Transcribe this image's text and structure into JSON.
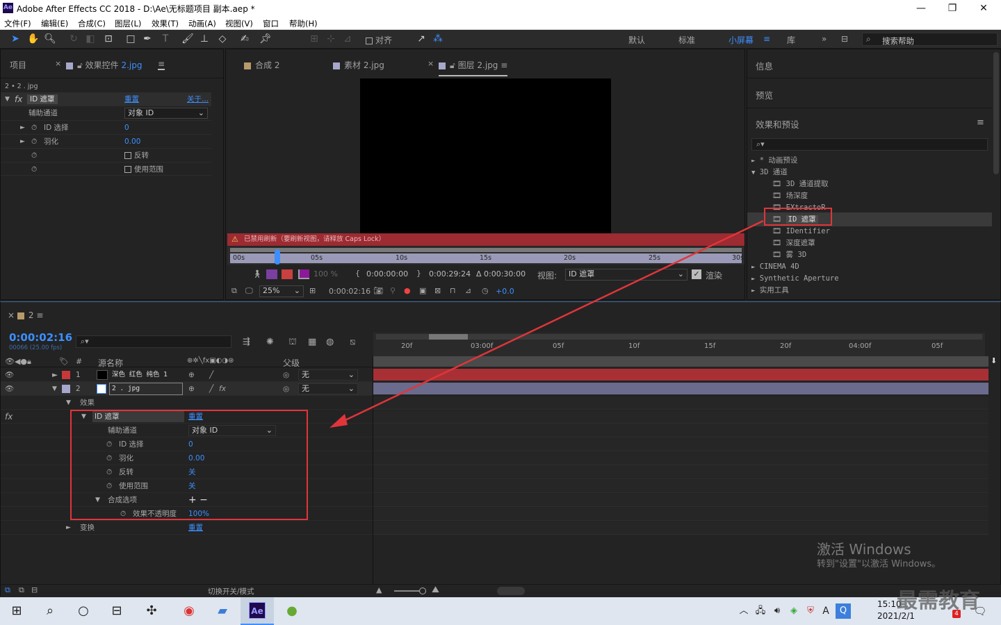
{
  "app": {
    "logo": "Ae",
    "title": "Adobe After Effects CC 2018 - D:\\Ae\\无标题项目 副本.aep *"
  },
  "window_controls": {
    "minimize": "—",
    "restore": "❐",
    "close": "✕"
  },
  "menu": [
    "文件(F)",
    "编辑(E)",
    "合成(C)",
    "图层(L)",
    "效果(T)",
    "动画(A)",
    "视图(V)",
    "窗口",
    "帮助(H)"
  ],
  "toolbar": {
    "align_label": "对齐",
    "workspaces": [
      "默认",
      "标准",
      "小屏幕",
      "库"
    ],
    "active_workspace": "小屏幕",
    "search_placeholder": "搜索帮助"
  },
  "left_panel": {
    "tab_project": "项目",
    "tab_effects_prefix": "效果控件",
    "tab_effects_layer": "2.jpg",
    "breadcrumb": "2 • 2 . jpg",
    "effect_name": "ID 遮罩",
    "reset": "重置",
    "about": "关于...",
    "props": [
      {
        "label": "辅助通道",
        "value": "对象 ID"
      },
      {
        "label": "ID 选择",
        "value": "0"
      },
      {
        "label": "羽化",
        "value": "0.00"
      },
      {
        "label": "",
        "value": "反转"
      },
      {
        "label": "",
        "value": "使用范围"
      }
    ]
  },
  "comp_panel": {
    "tabs": [
      "合成 2",
      "素材 2.jpg",
      "图层 2.jpg"
    ],
    "warning": "已禁用刷新（要刷新视图，请释放 Caps Lock）",
    "ruler": [
      "00s",
      "05s",
      "10s",
      "15s",
      "20s",
      "25s",
      "30s"
    ],
    "time_in": "0:00:00:00",
    "time_out": "0:00:29:24",
    "duration": "Δ 0:00:30:00",
    "view_label": "视图:",
    "view_value": "ID 遮罩",
    "render_label": "渲染",
    "zoom": "25%",
    "current_time": "0:00:02:16",
    "exposure": "+0.0",
    "opacity_pct": "100 %"
  },
  "right_panel": {
    "info": "信息",
    "preview": "预览",
    "effects_presets": "效果和预设",
    "tree": [
      {
        "label": "* 动画预设",
        "level": 0,
        "arrow": "►"
      },
      {
        "label": "3D 通道",
        "level": 0,
        "arrow": "▼"
      },
      {
        "label": "3D 通道提取",
        "level": 1
      },
      {
        "label": "场深度",
        "level": 1
      },
      {
        "label": "EXtractoR",
        "level": 1
      },
      {
        "label": "ID 遮罩",
        "level": 1,
        "selected": true
      },
      {
        "label": "IDentifier",
        "level": 1
      },
      {
        "label": "深度遮罩",
        "level": 1
      },
      {
        "label": "雾 3D",
        "level": 1
      },
      {
        "label": "CINEMA 4D",
        "level": 0,
        "arrow": "►"
      },
      {
        "label": "Synthetic Aperture",
        "level": 0,
        "arrow": "►"
      },
      {
        "label": "实用工具",
        "level": 0,
        "arrow": "►"
      }
    ]
  },
  "timeline": {
    "comp_tab": "2",
    "timecode": "0:00:02:16",
    "frames": "00066 (25.00 fps)",
    "col_source": "源名称",
    "col_parent": "父级",
    "col_num": "#",
    "ruler": [
      "20f",
      "03:00f",
      "05f",
      "10f",
      "15f",
      "20f",
      "04:00f",
      "05f"
    ],
    "layers": [
      {
        "num": "1",
        "name": "深色 红色 纯色 1",
        "parent": "无",
        "color": "#c8383a"
      },
      {
        "num": "2",
        "name": "2 . jpg",
        "parent": "无",
        "color": "#a7a7cc"
      }
    ],
    "effects_label": "效果",
    "effect_name": "ID 遮罩",
    "effect_reset": "重置",
    "effect_props": [
      {
        "label": "辅助通道",
        "value": "对象 ID"
      },
      {
        "label": "ID 选择",
        "value": "0"
      },
      {
        "label": "羽化",
        "value": "0.00"
      },
      {
        "label": "反转",
        "value": "关"
      },
      {
        "label": "使用范围",
        "value": "关"
      },
      {
        "label": "合成选项",
        "value": "+ −"
      },
      {
        "label": "效果不透明度",
        "value": "100%"
      }
    ],
    "transform_label": "变换",
    "transform_reset": "重置",
    "footer_toggle": "切换开关/模式"
  },
  "watermark": {
    "line1": "激活 Windows",
    "line2": "转到\"设置\"以激活 Windows。",
    "brand": "最需教育"
  },
  "taskbar": {
    "time": "15:10",
    "date": "2021/2/1",
    "ime": "A",
    "badge": "4"
  },
  "colors": {
    "accent": "#3d8fff",
    "highlight_box": "#e0353a",
    "warning": "#9c2b32",
    "layer_red": "#a83034",
    "layer_lavender": "#6b6b8e"
  }
}
